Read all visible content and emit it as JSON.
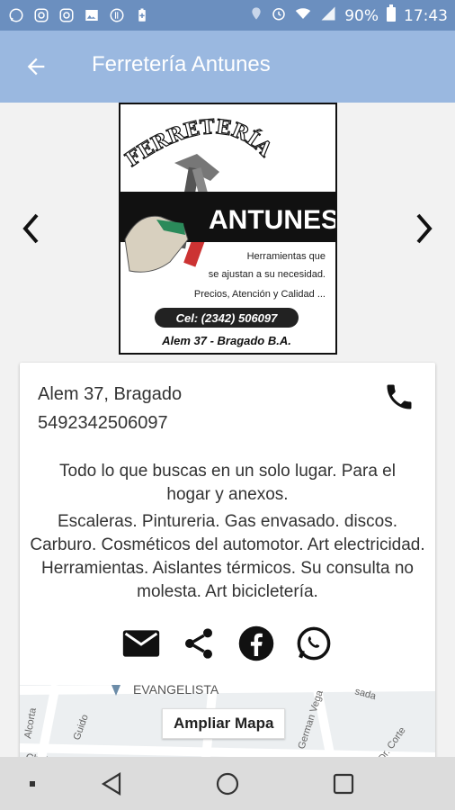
{
  "status_bar": {
    "battery": "90%",
    "time": "17:43"
  },
  "app_bar": {
    "title": "Ferretería Antunes"
  },
  "logo": {
    "header": "FERRETERÍA",
    "brand": "ANTUNES",
    "tagline_1": "Herramientas que",
    "tagline_2": "se ajustan a su necesidad.",
    "tagline_3": "Precios, Atención y Calidad ...",
    "cel": "Cel: (2342) 506097",
    "address": "Alem 37 - Bragado B.A."
  },
  "card": {
    "address": "Alem 37, Bragado",
    "phone": "5492342506097",
    "description_1": "Todo lo que buscas en un solo lugar. Para el hogar y anexos.",
    "description_2": "Escaleras. Pintureria. Gas envasado. discos. Carburo. Cosméticos del automotor. Art electricidad. Herramientas. Aislantes térmicos. Su consulta no molesta. Art bicicletería."
  },
  "map": {
    "button_label": "Ampliar Mapa",
    "streets": [
      "EVANGELISTA",
      "Alcorta",
      "Guido",
      "Chubut",
      "German Vega",
      "Dr. Corte",
      "sada"
    ]
  },
  "colors": {
    "status_bar": "#6b8fbf",
    "app_bar": "#9ab8e0",
    "background": "#f2f2f2"
  }
}
